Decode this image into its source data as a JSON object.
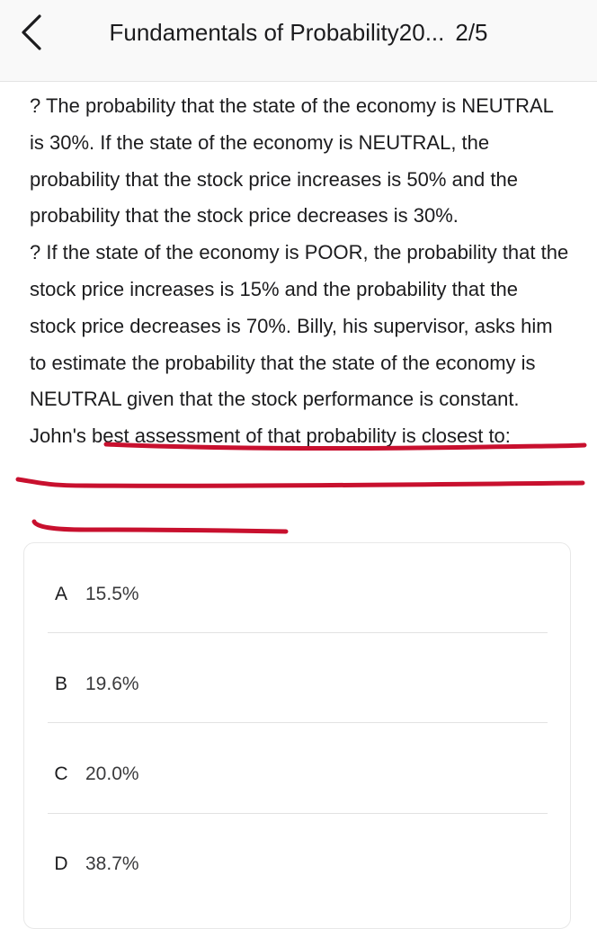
{
  "header": {
    "back_icon": "chevron-left-icon",
    "title": "Fundamentals of Probability20...",
    "progress": "2/5"
  },
  "question": {
    "paragraph1": "? The probability that the state of the economy is NEUTRAL is 30%. If the state of the economy is NEUTRAL, the probability that the stock price increases is 50% and the probability that the stock price decreases is 30%.",
    "paragraph2": "? If the state of the economy is POOR, the probability that the stock price increases is 15% and the probability that the stock price decreases is 70%. Billy, his supervisor, asks him to estimate the probability that the state of the economy is NEUTRAL given that the stock performance is constant. John's best assessment of that probability is closest to:"
  },
  "annotation": {
    "color": "#c8102e"
  },
  "options": [
    {
      "letter": "A",
      "value": "15.5%"
    },
    {
      "letter": "B",
      "value": "19.6%"
    },
    {
      "letter": "C",
      "value": "20.0%"
    },
    {
      "letter": "D",
      "value": "38.7%"
    }
  ]
}
